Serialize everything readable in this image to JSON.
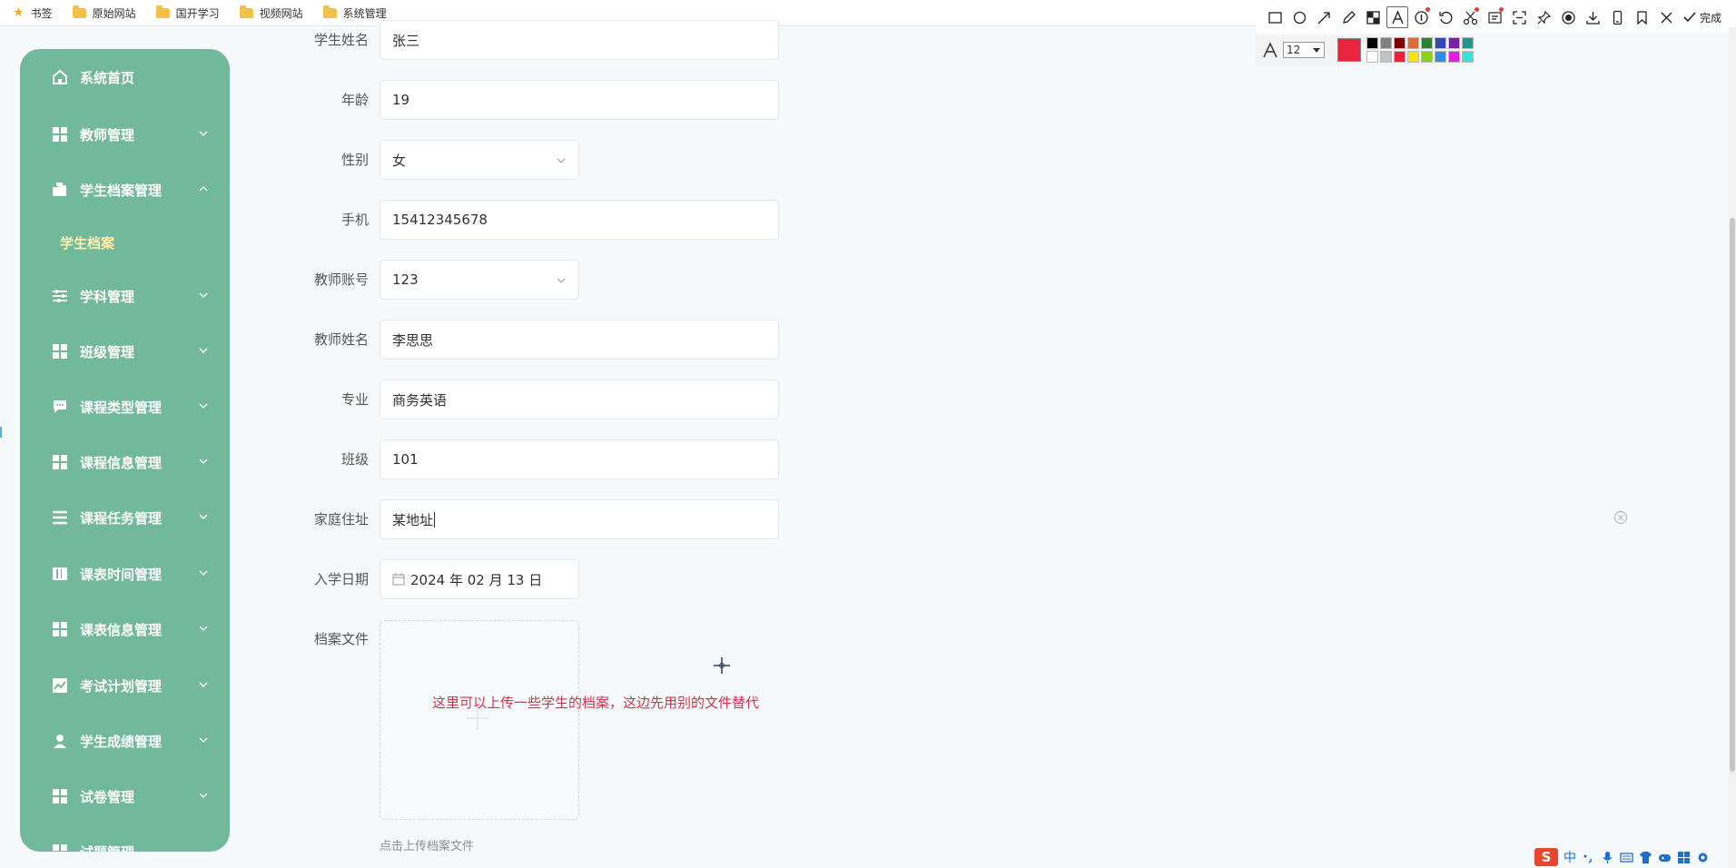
{
  "bookmarks": [
    {
      "label": "书签",
      "icon": "star-icon"
    },
    {
      "label": "原始网站",
      "icon": "folder-icon"
    },
    {
      "label": "国开学习",
      "icon": "folder-icon"
    },
    {
      "label": "视频网站",
      "icon": "folder-icon"
    },
    {
      "label": "系统管理",
      "icon": "folder-icon"
    }
  ],
  "sidebar": {
    "items": [
      {
        "label": "系统首页",
        "icon": "home-icon"
      },
      {
        "label": "教师管理",
        "icon": "grid-icon"
      },
      {
        "label": "学生档案管理",
        "icon": "folder-open-icon",
        "expanded": true
      },
      {
        "label": "学科管理",
        "icon": "sliders-icon"
      },
      {
        "label": "班级管理",
        "icon": "grid-icon"
      },
      {
        "label": "课程类型管理",
        "icon": "chat-icon"
      },
      {
        "label": "课程信息管理",
        "icon": "grid-icon"
      },
      {
        "label": "课程任务管理",
        "icon": "list-icon"
      },
      {
        "label": "课表时间管理",
        "icon": "book-icon"
      },
      {
        "label": "课表信息管理",
        "icon": "grid-icon"
      },
      {
        "label": "考试计划管理",
        "icon": "chart-icon"
      },
      {
        "label": "学生成绩管理",
        "icon": "user-icon"
      },
      {
        "label": "试卷管理",
        "icon": "grid-icon"
      }
    ],
    "sub_item": "学生档案",
    "partial_item": "试题管理"
  },
  "form": {
    "student_name": {
      "label": "学生姓名",
      "value": "张三"
    },
    "age": {
      "label": "年龄",
      "value": "19"
    },
    "gender": {
      "label": "性别",
      "value": "女"
    },
    "phone": {
      "label": "手机",
      "value": "15412345678"
    },
    "teacher_account": {
      "label": "教师账号",
      "value": "123"
    },
    "teacher_name": {
      "label": "教师姓名",
      "value": "李思思"
    },
    "major": {
      "label": "专业",
      "value": "商务英语"
    },
    "class": {
      "label": "班级",
      "value": "101"
    },
    "address": {
      "label": "家庭住址",
      "value": "某地址"
    },
    "enroll_date": {
      "label": "入学日期",
      "value": "2024 年 02 月 13 日"
    },
    "archive_file": {
      "label": "档案文件",
      "hint": "点击上传档案文件"
    }
  },
  "annotation": "这里可以上传一些学生的档案，这边先用别的文件替代",
  "screenshot_tool": {
    "done_label": "完成",
    "font_size": "12",
    "current_color": "#e8243f",
    "palette": [
      "#000000",
      "#808080",
      "#800000",
      "#e26b2f",
      "#2f7d32",
      "#2f49b5",
      "#7a1fa2",
      "#1f9a8a",
      "#ffffff",
      "#c0c0c0",
      "#e8243f",
      "#f2e416",
      "#8bd117",
      "#2f8fe8",
      "#e020e0",
      "#3ae0d6"
    ]
  },
  "ime": {
    "lang": "中",
    "logo": "S"
  }
}
